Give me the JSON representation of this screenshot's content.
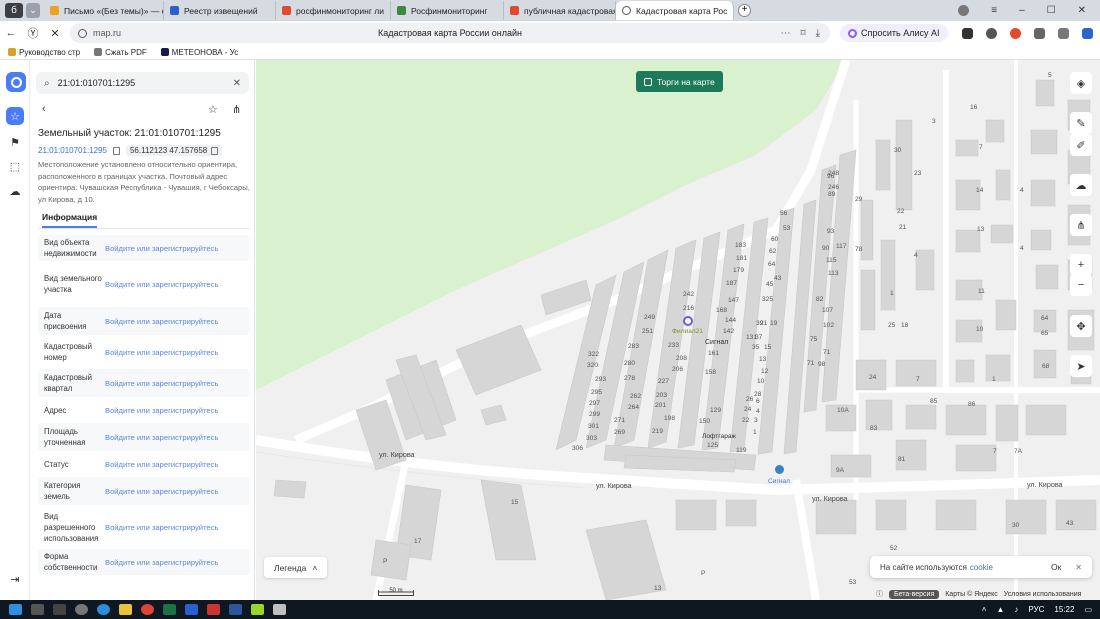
{
  "browser": {
    "tabs": [
      {
        "label": "Письмо «(Без темы)» — с",
        "color": "#f0a020"
      },
      {
        "label": "Реестр извещений",
        "color": "#2a5fd0"
      },
      {
        "label": "росфинмониторинг ли",
        "color": "#e04a2f"
      },
      {
        "label": "Росфинмониторинг",
        "color": "#3c8a3c"
      },
      {
        "label": "публичная кадастровая",
        "color": "#e04a2f"
      },
      {
        "label": "Кадастровая карта Рос",
        "color": "#777777"
      }
    ],
    "url": "map.ru",
    "page_title": "Кадастровая карта России онлайн",
    "alice_label": "Спросить Алису AI",
    "bookmarks": [
      "Руководство стр",
      "Сжать PDF",
      "МЕТЕОНОВА - Ус"
    ]
  },
  "panel": {
    "search_value": "21:01:010701:1295",
    "title": "Земельный участок: 21:01:010701:1295",
    "cad_number": "21:01:010701:1295",
    "coords": "56.112123 47.157658",
    "description": "Местоположение установлено относительно ориентира, расположенного в границах участка. Почтовый адрес ориентира: Чувашская Республика - Чувашия, г Чебоксары, ул Кирова, д 10.",
    "info_tab": "Информация",
    "rows": [
      {
        "label": "Вид объекта недвижимости",
        "value": "Войдите или зарегистрируйтесь"
      },
      {
        "label": "Вид земельного участка",
        "value": "Войдите или зарегистрируйтесь"
      },
      {
        "label": "Дата присвоения",
        "value": "Войдите или зарегистрируйтесь"
      },
      {
        "label": "Кадастровый номер",
        "value": "Войдите или зарегистрируйтесь"
      },
      {
        "label": "Кадастровый квартал",
        "value": "Войдите или зарегистрируйтесь"
      },
      {
        "label": "Адрес",
        "value": "Войдите или зарегистрируйтесь"
      },
      {
        "label": "Площадь уточненная",
        "value": "Войдите или зарегистрируйтесь"
      },
      {
        "label": "Статус",
        "value": "Войдите или зарегистрируйтесь"
      },
      {
        "label": "Категория земель",
        "value": "Войдите или зарегистрируйтесь"
      },
      {
        "label": "Вид разрешенного использования",
        "value": "Войдите или зарегистрируйтесь"
      },
      {
        "label": "Форма собственности",
        "value": "Войдите или зарегистрируйтесь"
      }
    ]
  },
  "map": {
    "torgi_label": "Торги на карте",
    "legend_label": "Легенда",
    "cookie_text": "На сайте используются",
    "cookie_link": "cookie",
    "cookie_ok": "Ок",
    "scale": "50 m",
    "beta": "Бета-версия",
    "attribution": "Карты © Яндекс",
    "terms": "Условия использования",
    "streets": [
      "ул. Кирова",
      "ул. Кирова",
      "ул. Кирова",
      "ул. Кирова"
    ],
    "garage_label": "Сигнал",
    "garage_label2": "Лофтгараж",
    "bus_stop": "Сигнал",
    "poi_name": "Филиал21",
    "colors": {
      "park": "#d9f1cf",
      "building": "#d9d9d9",
      "road": "#ffffff",
      "accent": "#1c7a5b"
    }
  },
  "taskbar": {
    "lang": "РУС",
    "time": "15:22"
  }
}
